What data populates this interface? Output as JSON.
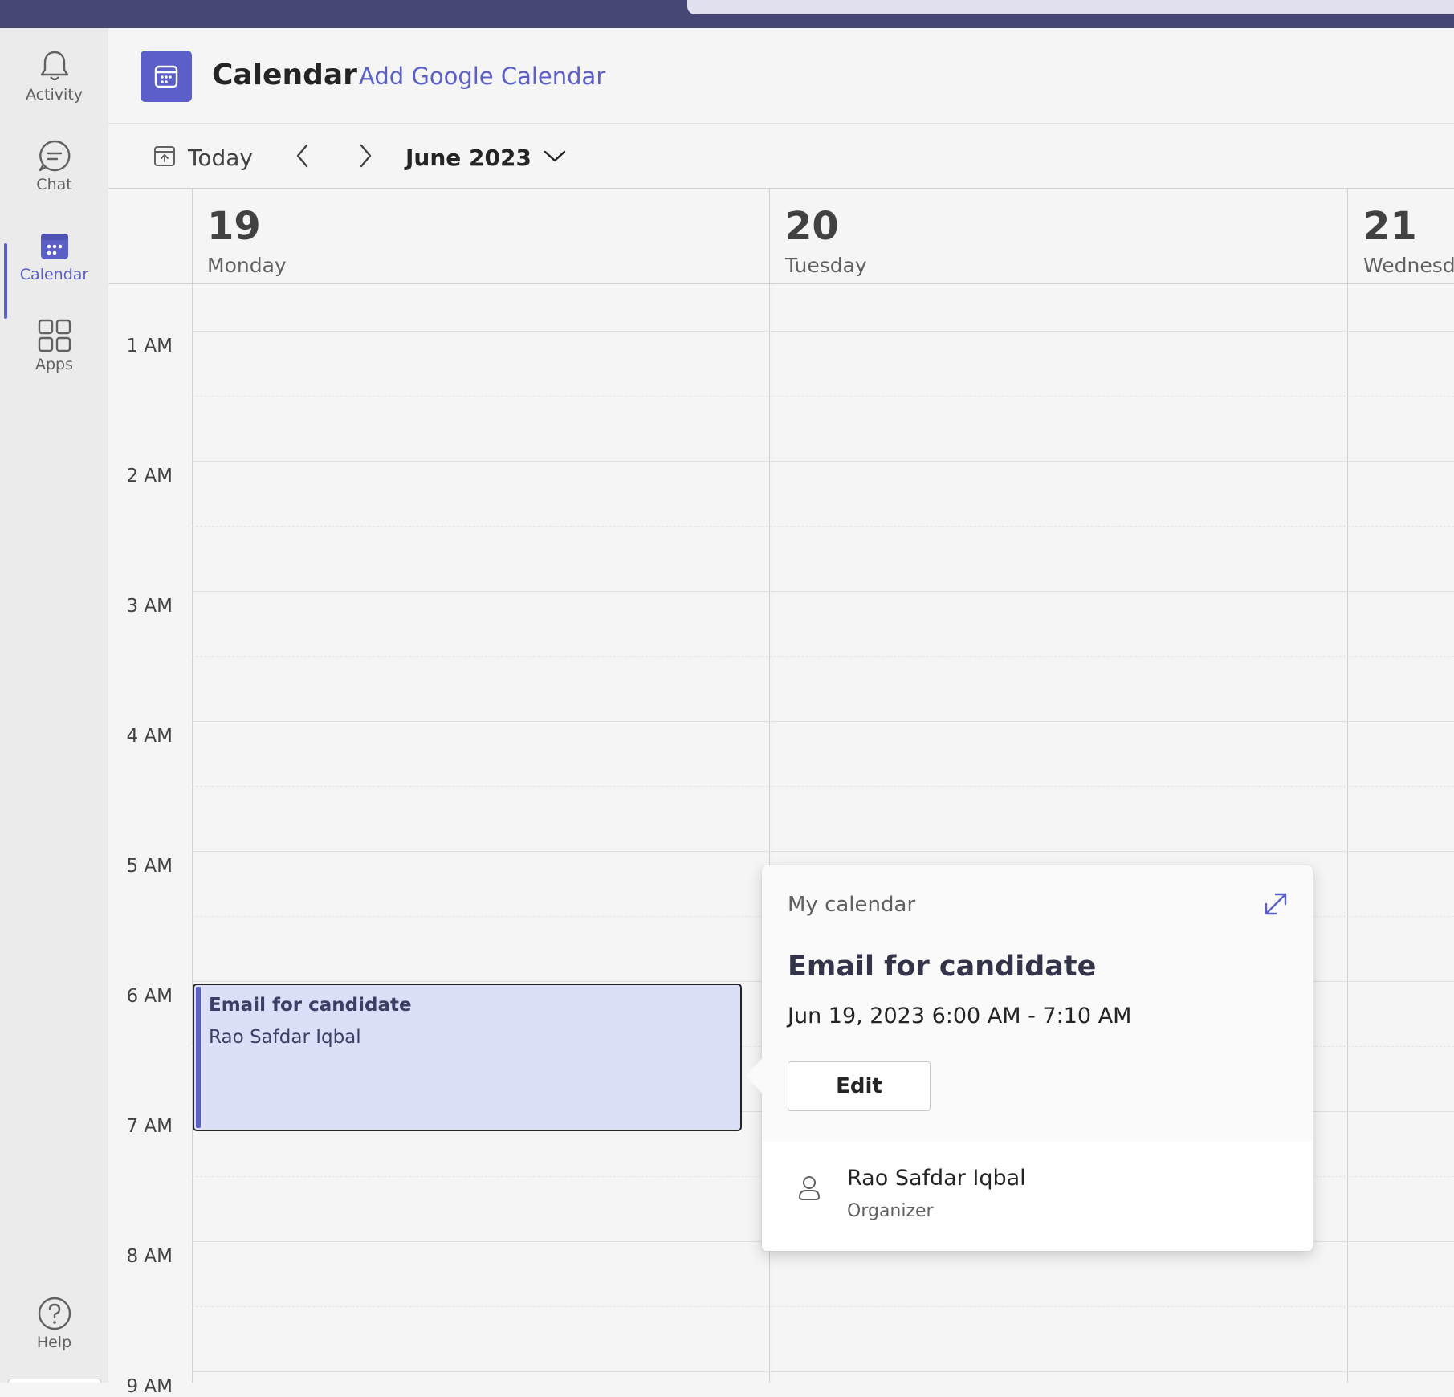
{
  "rail": {
    "items": [
      {
        "label": "Activity",
        "icon": "bell-icon"
      },
      {
        "label": "Chat",
        "icon": "chat-icon"
      },
      {
        "label": "Calendar",
        "icon": "calendar-icon"
      },
      {
        "label": "Apps",
        "icon": "apps-icon"
      }
    ],
    "help": {
      "label": "Help",
      "icon": "help-icon"
    }
  },
  "header": {
    "title": "Calendar",
    "add_google": "Add Google Calendar"
  },
  "toolbar": {
    "today": "Today",
    "month": "June 2023"
  },
  "days": [
    {
      "num": "19",
      "name": "Monday"
    },
    {
      "num": "20",
      "name": "Tuesday"
    },
    {
      "num": "21",
      "name": "Wednesda"
    }
  ],
  "hours": [
    "1 AM",
    "2 AM",
    "3 AM",
    "4 AM",
    "5 AM",
    "6 AM",
    "7 AM",
    "8 AM",
    "9 AM"
  ],
  "event": {
    "title": "Email for candidate",
    "organizer": "Rao Safdar Iqbal"
  },
  "popup": {
    "calendar_name": "My calendar",
    "title": "Email for candidate",
    "time": "Jun 19, 2023 6:00 AM - 7:10 AM",
    "edit_label": "Edit",
    "person_name": "Rao Safdar Iqbal",
    "person_role": "Organizer"
  },
  "colors": {
    "accent": "#5b5fc7",
    "topbar": "#464775",
    "event_fill": "#dcdff8"
  }
}
